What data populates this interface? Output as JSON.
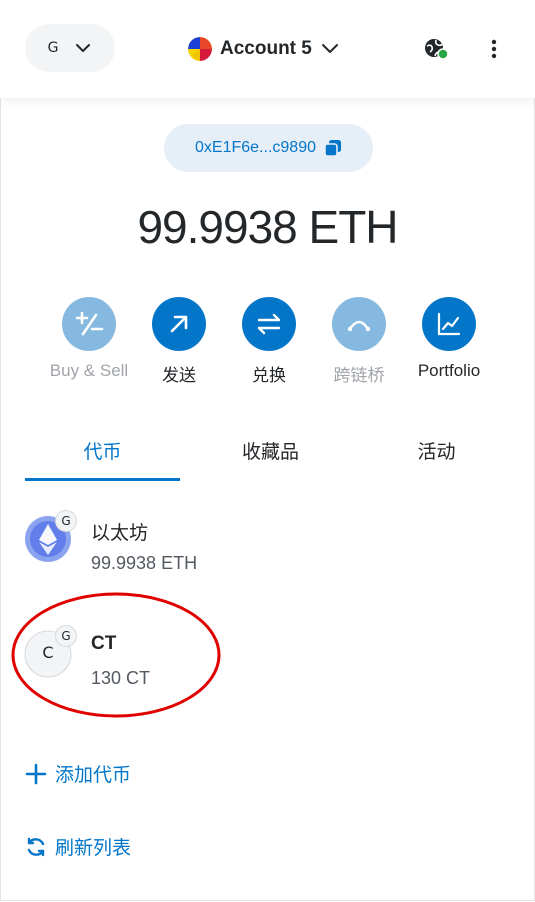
{
  "header": {
    "network_letter": "G",
    "account_name": "Account 5"
  },
  "address": {
    "short": "0xE1F6e...c9890"
  },
  "balance": {
    "display": "99.9938 ETH"
  },
  "actions": [
    {
      "label": "Buy & Sell",
      "icon": "plus-minus-icon",
      "enabled": false
    },
    {
      "label": "发送",
      "icon": "arrow-up-right-icon",
      "enabled": true
    },
    {
      "label": "兑换",
      "icon": "swap-arrows-icon",
      "enabled": true
    },
    {
      "label": "跨链桥",
      "icon": "bridge-icon",
      "enabled": false
    },
    {
      "label": "Portfolio",
      "icon": "chart-line-icon",
      "enabled": true
    }
  ],
  "tabs": [
    {
      "label": "代币",
      "selected": true
    },
    {
      "label": "收藏品",
      "selected": false
    },
    {
      "label": "活动",
      "selected": false
    }
  ],
  "tokens": [
    {
      "name": "以太坊",
      "amount": "99.9938 ETH",
      "badge": "G",
      "icon": "ethereum-icon"
    },
    {
      "name": "CT",
      "amount": "130 CT",
      "badge": "G",
      "icon_letter": "C",
      "highlighted": true
    }
  ],
  "links": {
    "add_token": "添加代币",
    "refresh_list": "刷新列表"
  },
  "colors": {
    "primary": "#0376c9",
    "primary_disabled": "#86b9e0",
    "annotation_red": "#e00000"
  }
}
